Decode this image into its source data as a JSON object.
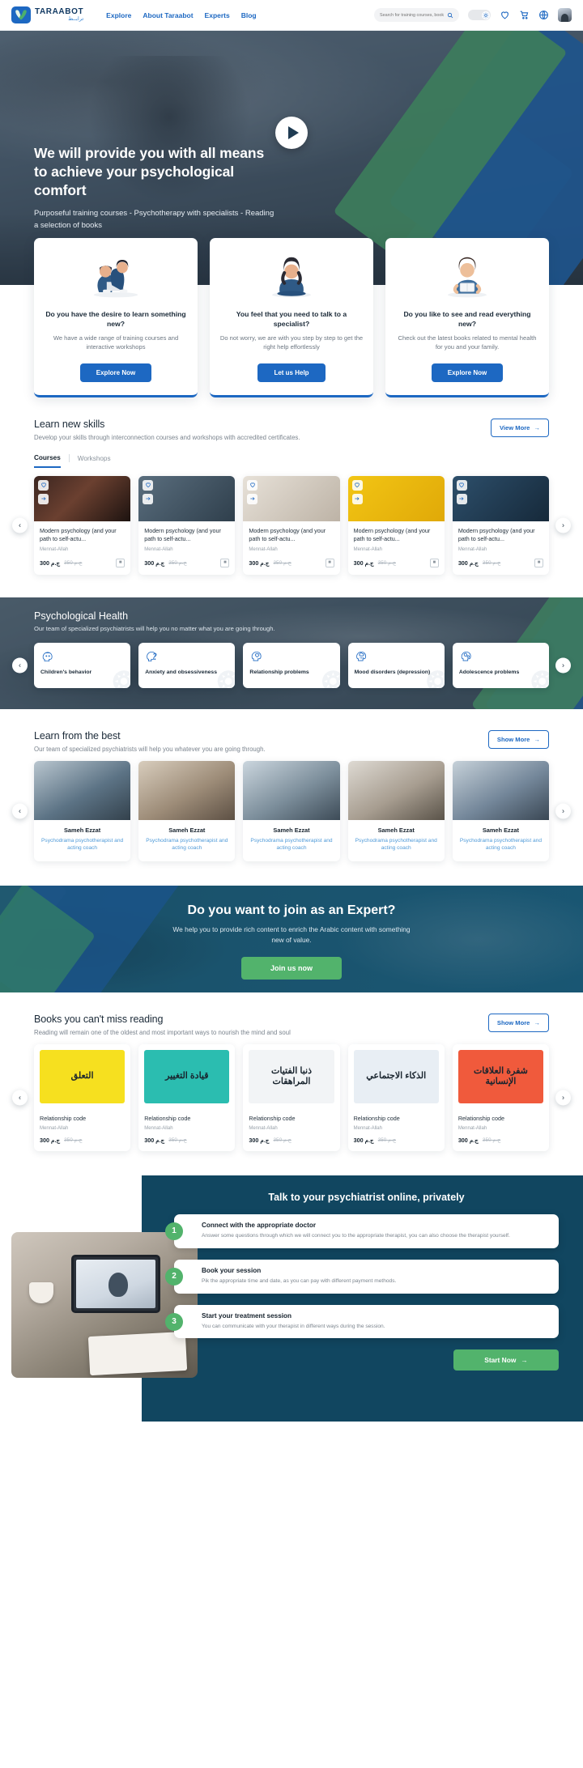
{
  "header": {
    "logo_name": "TARAABOT",
    "logo_sub": "ترابــط",
    "nav": [
      {
        "label": "Explore"
      },
      {
        "label": "About Taraabot"
      },
      {
        "label": "Experts"
      },
      {
        "label": "Blog"
      }
    ],
    "search_placeholder": "Search for training courses, books, trainers",
    "icons": {
      "search": "search-icon",
      "theme_toggle": "theme-toggle",
      "wishlist": "heart-icon",
      "cart": "cart-icon",
      "language": "globe-icon",
      "avatar": "user-avatar"
    }
  },
  "hero": {
    "title": "We will provide you with all means to achieve your psychological comfort",
    "subtitle": "Purposeful training courses - Psychotherapy with specialists - Reading a selection of books",
    "play_label": "play-video"
  },
  "promos": [
    {
      "title": "Do you have the desire to learn something new?",
      "text": "We have a wide range of training courses and interactive workshops",
      "button": "Explore Now"
    },
    {
      "title": "You feel that you need to talk to a specialist?",
      "text": "Do not worry, we are with you step by step to get the right help effortlessly",
      "button": "Let us Help"
    },
    {
      "title": "Do you like to see and read everything new?",
      "text": "Check out the latest books related to mental health for you and your family.",
      "button": "Explore Now"
    }
  ],
  "skills": {
    "title": "Learn new skills",
    "subtitle": "Develop your skills through interconnection courses and workshops with accredited certificates.",
    "view_more": "View More",
    "tabs": [
      {
        "label": "Courses",
        "active": true
      },
      {
        "label": "Workshops",
        "active": false
      }
    ],
    "courses": [
      {
        "title": "Modern psychology (and your path to self-actu...",
        "author": "Mennat-Allah",
        "price": "300 ج.م",
        "old_price": "350 ج.م"
      },
      {
        "title": "Modern psychology (and your path to self-actu...",
        "author": "Mennat-Allah",
        "price": "300 ج.م",
        "old_price": "350 ج.م"
      },
      {
        "title": "Modern psychology (and your path to self-actu...",
        "author": "Mennat-Allah",
        "price": "300 ج.م",
        "old_price": "350 ج.م"
      },
      {
        "title": "Modern psychology (and your path to self-actu...",
        "author": "Mennat-Allah",
        "price": "300 ج.م",
        "old_price": "350 ج.م"
      },
      {
        "title": "Modern psychology (and your path to self-actu...",
        "author": "Mennat-Allah",
        "price": "300 ج.م",
        "old_price": "350 ج.م"
      }
    ]
  },
  "health": {
    "title": "Psychological Health",
    "subtitle": "Our team of specialized psychiatrists will help you no matter what you are going through.",
    "items": [
      {
        "label": "Children's behavior",
        "icon": "head-child-icon"
      },
      {
        "label": "Anxiety and obsessiveness",
        "icon": "head-question-icon"
      },
      {
        "label": "Relationship problems",
        "icon": "head-heart-icon"
      },
      {
        "label": "Mood disorders (depression)",
        "icon": "head-cloud-rain-icon"
      },
      {
        "label": "Adolescence problems",
        "icon": "head-gears-icon"
      }
    ]
  },
  "experts": {
    "title": "Learn from the best",
    "subtitle": "Our team of specialized psychiatrists will help you whatever you are going through.",
    "show_more": "Show More",
    "people": [
      {
        "name": "Sameh Ezzat",
        "role": "Psychodrama psychotherapist and acting coach"
      },
      {
        "name": "Sameh Ezzat",
        "role": "Psychodrama psychotherapist and acting coach"
      },
      {
        "name": "Sameh Ezzat",
        "role": "Psychodrama psychotherapist and acting coach"
      },
      {
        "name": "Sameh Ezzat",
        "role": "Psychodrama psychotherapist and acting coach"
      },
      {
        "name": "Sameh Ezzat",
        "role": "Psychodrama psychotherapist and acting coach"
      }
    ]
  },
  "join": {
    "title": "Do you want to join as an Expert?",
    "text": "We help you to provide rich content to enrich the Arabic content with something new of value.",
    "button": "Join us now"
  },
  "books": {
    "title": "Books you can't miss reading",
    "subtitle": "Reading will remain one of the oldest and most important ways to nourish the mind and soul",
    "show_more": "Show More",
    "items": [
      {
        "title": "Relationship code",
        "author": "Mennat-Allah",
        "price": "300 ج.م",
        "old_price": "350 ج.م",
        "cover_title": "التعلق",
        "cover_color": "#f6e01f"
      },
      {
        "title": "Relationship code",
        "author": "Mennat-Allah",
        "price": "300 ج.م",
        "old_price": "350 ج.م",
        "cover_title": "قيادة التغيير",
        "cover_color": "#2bbdb0"
      },
      {
        "title": "Relationship code",
        "author": "Mennat-Allah",
        "price": "300 ج.م",
        "old_price": "350 ج.م",
        "cover_title": "ذنبا الفتيات المراهقات",
        "cover_color": "#f2f4f6"
      },
      {
        "title": "Relationship code",
        "author": "Mennat-Allah",
        "price": "300 ج.م",
        "old_price": "350 ج.م",
        "cover_title": "الذكاء الاجتماعي",
        "cover_color": "#e8eef4"
      },
      {
        "title": "Relationship code",
        "author": "Mennat-Allah",
        "price": "300 ج.م",
        "old_price": "350 ج.م",
        "cover_title": "شفرة العلاقات الإنسانية",
        "cover_color": "#f05a3c"
      }
    ]
  },
  "talk": {
    "title": "Talk to your psychiatrist online, privately",
    "steps": [
      {
        "num": "1",
        "title": "Connect with the appropriate doctor",
        "text": "Answer some questions through which we will connect you to the appropriate therapist, you can also choose the therapist yourself."
      },
      {
        "num": "2",
        "title": "Book your session",
        "text": "Pik the appropriate time and date, as you can pay with different payment methods."
      },
      {
        "num": "3",
        "title": "Start your treatment session",
        "text": "You can communicate with your therapist in different ways during the session."
      }
    ],
    "button": "Start Now"
  },
  "colors": {
    "brand_blue": "#1d68c2",
    "brand_green": "#52b36c",
    "dark_navy": "#114660"
  }
}
